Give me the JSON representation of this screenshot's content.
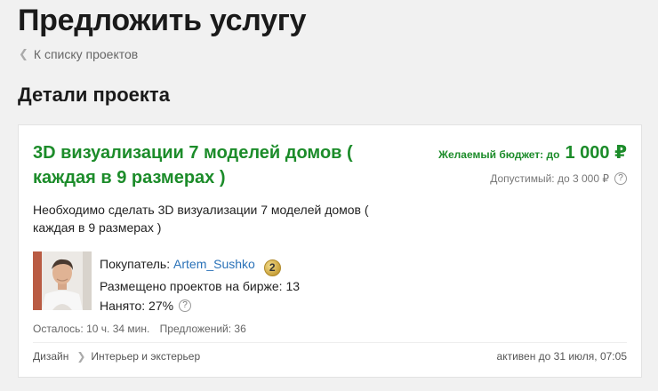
{
  "page": {
    "title": "Предложить услугу",
    "back_link": "К списку проектов",
    "section_title": "Детали проекта"
  },
  "project": {
    "title": "3D визуализации 7 моделей домов ( каждая в 9 размерах )",
    "budget_label": "Желаемый бюджет: до",
    "budget_value": "1 000 ₽",
    "allowed_budget": "Допустимый: до 3 000 ₽",
    "description": "Необходимо сделать 3D визуализации 7 моделей домов ( каждая в 9 размерах )",
    "buyer_label": "Покупатель:",
    "buyer_name": "Artem_Sushko",
    "buyer_level": "2",
    "projects_posted": "Размещено проектов на бирже: 13",
    "hired": "Нанято: 27%",
    "time_left": "Осталось: 10 ч. 34 мин.",
    "offers": "Предложений: 36",
    "category": "Дизайн",
    "subcategory": "Интерьер и экстерьер",
    "active_until": "активен до 31 июля, 07:05"
  },
  "icons": {
    "back": "chevron-left-icon",
    "help": "question-circle-icon",
    "level": "level-badge-icon",
    "category_sep": "chevron-right-icon"
  },
  "colors": {
    "accent_green": "#1c8c2a",
    "link_blue": "#2a72b8"
  }
}
